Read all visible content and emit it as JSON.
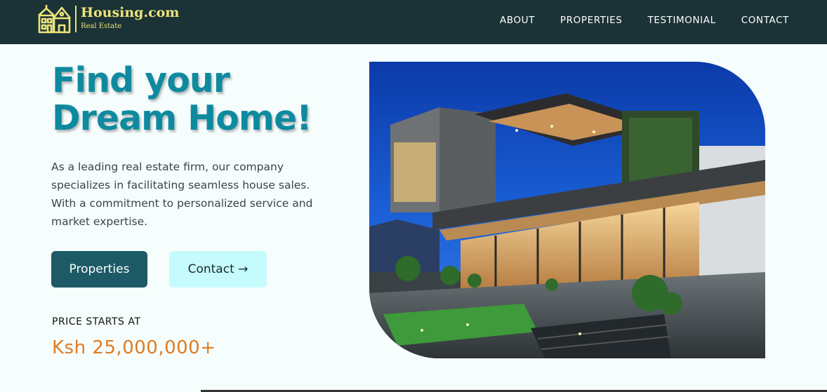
{
  "brand": {
    "name": "Housing.com",
    "tagline": "Real Estate"
  },
  "nav": {
    "items": [
      "ABOUT",
      "PROPERTIES",
      "TESTIMONIAL",
      "CONTACT"
    ]
  },
  "hero": {
    "title_line1": "Find your",
    "title_line2": "Dream Home!",
    "description": "As a leading real estate firm, our company specializes in facilitating seamless house sales. With a commitment to personalized service and market expertise.",
    "primary_button": "Properties",
    "secondary_button": "Contact →",
    "price_label": "PRICE STARTS AT",
    "price_value": "Ksh 25,000,000+"
  },
  "colors": {
    "header_bg": "#1b3236",
    "logo_yellow": "#ede47a",
    "title_teal": "#0e8aa0",
    "primary_button": "#1c5a66",
    "secondary_button": "#c6fbfd",
    "price_orange": "#e07b22"
  },
  "icons": {
    "logo": "house-icon",
    "hero_image": "modern-house-photo"
  }
}
